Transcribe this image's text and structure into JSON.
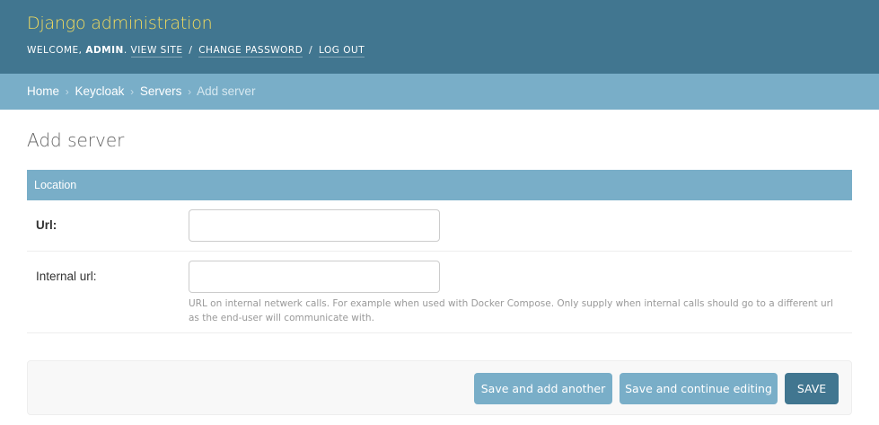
{
  "header": {
    "site_name": "Django administration",
    "welcome": "WELCOME,",
    "username": "ADMIN",
    "welcome_suffix": ".",
    "links": {
      "view_site": "VIEW SITE",
      "change_password": "CHANGE PASSWORD",
      "log_out": "LOG OUT"
    },
    "separator": "/"
  },
  "breadcrumbs": {
    "items": [
      "Home",
      "Keycloak",
      "Servers"
    ],
    "current": "Add server",
    "arrow": "›"
  },
  "page": {
    "title": "Add server"
  },
  "fieldset": {
    "title": "Location",
    "fields": [
      {
        "label": "Url:",
        "value": "",
        "required": true
      },
      {
        "label": "Internal url:",
        "value": "",
        "required": false,
        "help": "URL on internal netwerk calls. For example when used with Docker Compose. Only supply when internal calls should go to a different url as the end-user will communicate with."
      }
    ]
  },
  "submit_row": {
    "save_add_another": "Save and add another",
    "save_continue": "Save and continue editing",
    "save": "SAVE"
  },
  "colors": {
    "header_bg": "#417690",
    "site_name": "#f5dd5d",
    "breadcrumbs_bg": "#79aec8",
    "primary_button": "#417690",
    "secondary_button": "#79aec8"
  }
}
